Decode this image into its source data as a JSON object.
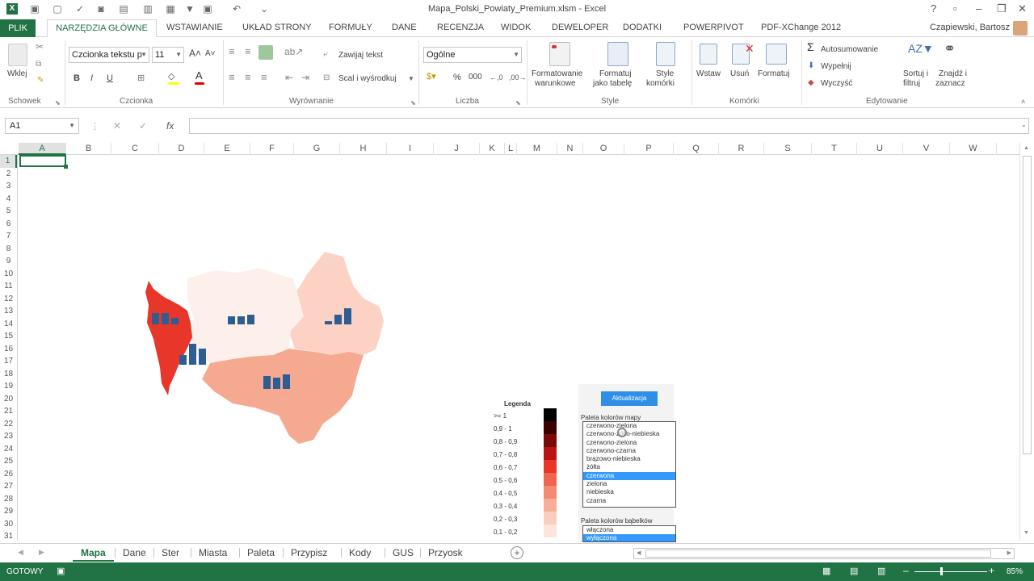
{
  "window": {
    "title": "Mapa_Polski_Powiaty_Premium.xlsm - Excel",
    "user": "Czapiewski, Bartosz"
  },
  "ribbon_tabs": [
    "PLIK",
    "NARZĘDZIA GŁÓWNE",
    "WSTAWIANIE",
    "UKŁAD STRONY",
    "FORMUŁY",
    "DANE",
    "RECENZJA",
    "WIDOK",
    "DEWELOPER",
    "DODATKI",
    "POWERPIVOT",
    "PDF-XChange 2012"
  ],
  "ribbon": {
    "paste": "Wklej",
    "font_name": "Czcionka tekstu p",
    "font_size": "11",
    "wrap_text": "Zawijaj tekst",
    "merge_center": "Scal i wyśrodkuj",
    "number_format": "Ogólne",
    "cond_format": [
      "Formatowanie",
      "warunkowe"
    ],
    "format_table": [
      "Formatuj",
      "jako tabelę"
    ],
    "cell_styles": [
      "Style",
      "komórki"
    ],
    "insert": "Wstaw",
    "delete": "Usuń",
    "format": "Formatuj",
    "autosum": "Autosumowanie",
    "fill": "Wypełnij",
    "clear": "Wyczyść",
    "sort_filter": [
      "Sortuj i",
      "filtruj"
    ],
    "find_select": [
      "Znajdź i",
      "zaznacz"
    ],
    "groups": [
      "Schowek",
      "Czcionka",
      "Wyrównanie",
      "Liczba",
      "Style",
      "Komórki",
      "Edytowanie"
    ]
  },
  "formula_bar": {
    "name_box": "A1",
    "fx": "fx",
    "value": ""
  },
  "columns": [
    "A",
    "B",
    "C",
    "D",
    "E",
    "F",
    "G",
    "H",
    "I",
    "J",
    "K",
    "L",
    "M",
    "N",
    "O",
    "P",
    "Q",
    "R",
    "S",
    "T",
    "U",
    "V",
    "W"
  ],
  "rows": [
    "1",
    "2",
    "3",
    "4",
    "5",
    "6",
    "7",
    "8",
    "9",
    "10",
    "11",
    "12",
    "13",
    "14",
    "15",
    "16",
    "17",
    "18",
    "19",
    "20",
    "21",
    "22",
    "23",
    "24",
    "25",
    "26",
    "27",
    "28",
    "29",
    "30",
    "31"
  ],
  "legend": {
    "title": "Legenda",
    "items": [
      {
        "label": ">=   1",
        "color": "#000000"
      },
      {
        "label": "0,9  -  1",
        "color": "#3d0000"
      },
      {
        "label": "0,8  -  0,9",
        "color": "#7a0a0a"
      },
      {
        "label": "0,7  -  0,8",
        "color": "#b81414"
      },
      {
        "label": "0,6  -  0,7",
        "color": "#e8362a"
      },
      {
        "label": "0,5  -  0,6",
        "color": "#f06450"
      },
      {
        "label": "0,4  -  0,5",
        "color": "#f58a72"
      },
      {
        "label": "0,3  -  0,4",
        "color": "#f8ad98"
      },
      {
        "label": "0,2  -  0,3",
        "color": "#fbcdbd"
      },
      {
        "label": "0,1  -  0,2",
        "color": "#fde5db"
      }
    ]
  },
  "panel": {
    "update_button": "Aktualizacja",
    "map_palette_label": "Paleta kolorów mapy",
    "map_palette_options": [
      "czerwono-zielona",
      "czerwono-żółto-niebieska",
      "czerwono-zielona",
      "czerwono-czarna",
      "brązowo-niebieska",
      "żółta",
      "czerwona",
      "zielona",
      "niebieska",
      "czarna"
    ],
    "map_palette_selected": 6,
    "bubble_palette_label": "Paleta kolorów bąbelków",
    "bubble_palette_options": [
      "włączona",
      "wyłączona"
    ],
    "bubble_palette_selected": 1
  },
  "sheet_tabs": [
    "Mapa",
    "Dane",
    "Ster",
    "Miasta",
    "Paleta",
    "Przypisz",
    "Kody",
    "GUS",
    "Przyosk"
  ],
  "active_sheet": "Mapa",
  "status": {
    "mode": "GOTOWY",
    "zoom": "85%"
  },
  "colors": {
    "excel_green": "#217346",
    "bar_blue": "#2e5d94"
  }
}
